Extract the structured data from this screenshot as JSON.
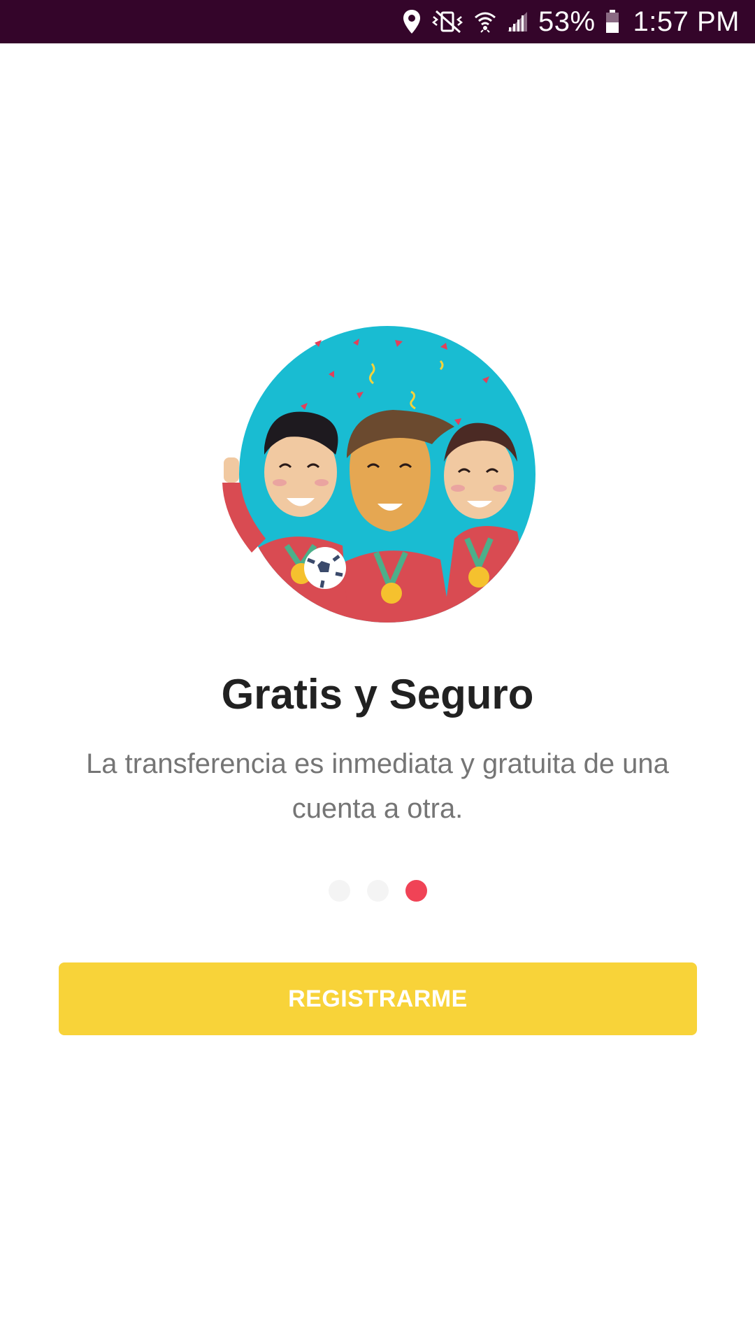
{
  "status_bar": {
    "battery_percent": "53%",
    "time": "1:57 PM",
    "icons": [
      "location-icon",
      "vibrate-off-icon",
      "wifi-icon",
      "signal-icon",
      "battery-icon"
    ]
  },
  "onboarding": {
    "illustration": "three-soccer-players-with-medals-illustration",
    "title": "Gratis y Seguro",
    "description": "La transferencia es inmediata y gratuita de una cuenta a otra.",
    "pager": {
      "total_pages": 3,
      "current_page": 3
    },
    "register_button_label": "REGISTRARME"
  },
  "colors": {
    "status_bar_bg": "#34052a",
    "accent_dot": "#f04356",
    "button_bg": "#f8d339",
    "title": "#212121",
    "description": "#757575",
    "illustration_bg": "#19bcd2"
  }
}
